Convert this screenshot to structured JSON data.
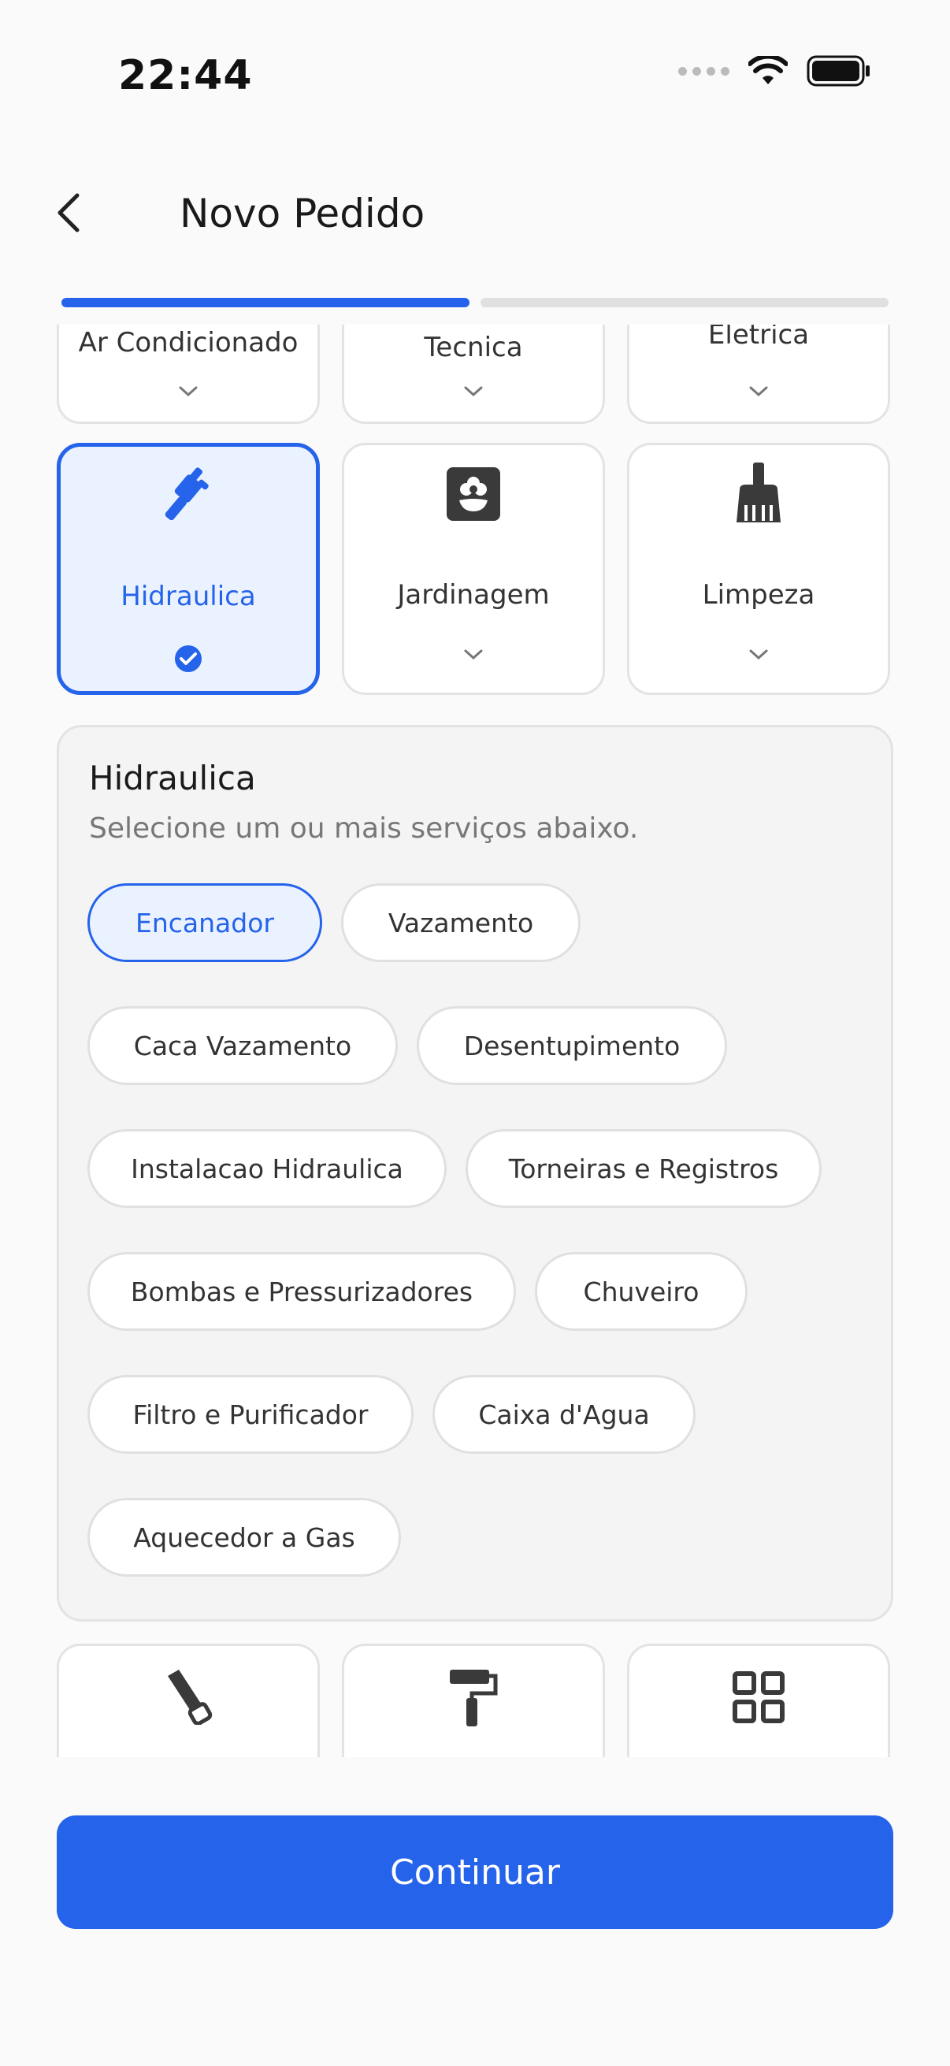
{
  "status_bar": {
    "time": "22:44"
  },
  "header": {
    "title": "Novo Pedido"
  },
  "progress": {
    "steps_total": 2,
    "current_step": 1,
    "active_color": "#2563eb",
    "inactive_color": "#e0e0e0"
  },
  "categories_top_partial": [
    {
      "label": "Ar Condicionado",
      "icon": "chevron-down-icon"
    },
    {
      "label": "Tecnica",
      "icon": "chevron-down-icon"
    },
    {
      "label": "Eletrica",
      "icon": "chevron-down-icon"
    }
  ],
  "categories": [
    {
      "label": "Hidraulica",
      "icon": "pipe-wrench-icon",
      "selected": true
    },
    {
      "label": "Jardinagem",
      "icon": "flower-icon",
      "selected": false
    },
    {
      "label": "Limpeza",
      "icon": "broom-icon",
      "selected": false
    }
  ],
  "categories_bottom_partial": [
    {
      "icon": "saw-icon"
    },
    {
      "icon": "paint-roller-icon"
    },
    {
      "icon": "grid-icon"
    }
  ],
  "panel": {
    "title": "Hidraulica",
    "subtitle": "Selecione um ou mais serviços abaixo.",
    "services": [
      {
        "label": "Encanador",
        "selected": true
      },
      {
        "label": "Vazamento",
        "selected": false
      },
      {
        "label": "Caca Vazamento",
        "selected": false
      },
      {
        "label": "Desentupimento",
        "selected": false
      },
      {
        "label": "Instalacao Hidraulica",
        "selected": false
      },
      {
        "label": "Torneiras e Registros",
        "selected": false
      },
      {
        "label": "Bombas e Pressurizadores",
        "selected": false
      },
      {
        "label": "Chuveiro",
        "selected": false
      },
      {
        "label": "Filtro e Purificador",
        "selected": false
      },
      {
        "label": "Caixa d'Agua",
        "selected": false
      },
      {
        "label": "Aquecedor a Gas",
        "selected": false
      }
    ]
  },
  "footer": {
    "continue_label": "Continuar"
  },
  "colors": {
    "accent": "#2563eb",
    "selected_bg": "#eaf2ff"
  }
}
